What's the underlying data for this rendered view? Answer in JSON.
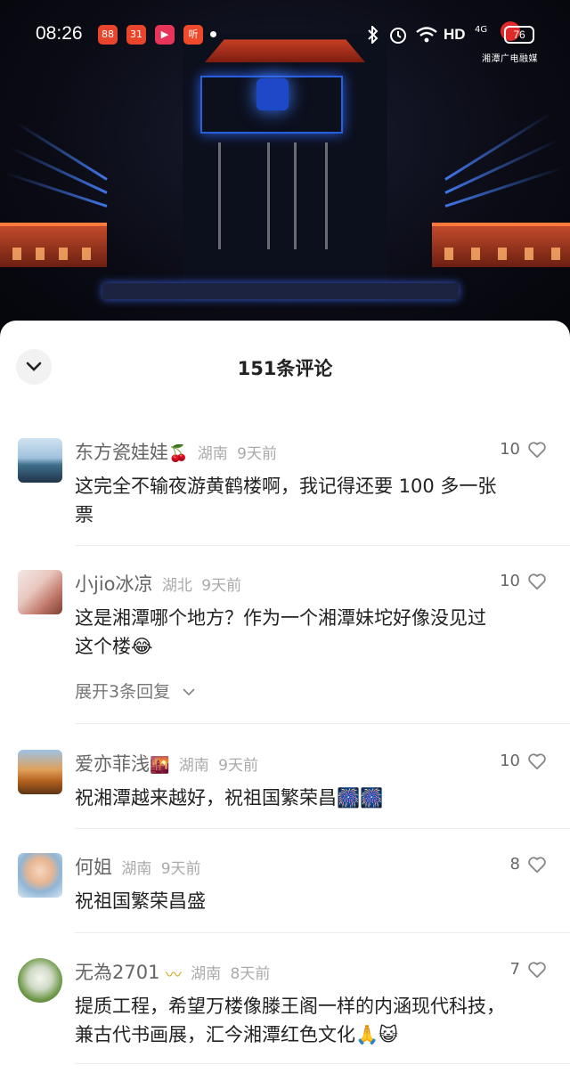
{
  "status_bar": {
    "time": "08:26",
    "apps": [
      "88",
      "31",
      "▶",
      "听"
    ],
    "hd": "HD",
    "signal": "4G",
    "battery": "76",
    "watermark": "湘潭广电融媒"
  },
  "sheet": {
    "title": "151条评论"
  },
  "comments": [
    {
      "name": "东方瓷娃娃",
      "emoji": "🍒",
      "region": "湖南",
      "time": "9天前",
      "likes": "10",
      "text_line1": "这完全不输夜游黄鹤楼啊，我记得还要 100 多一张",
      "text_line2": "票"
    },
    {
      "name": "小jio冰凉",
      "emoji": "",
      "region": "湖北",
      "time": "9天前",
      "likes": "10",
      "text_line1": "这是湘潭哪个地方？作为一个湘潭妹坨好像没见过",
      "text_line2": "这个楼😂",
      "expand_label": "展开3条回复"
    },
    {
      "name": "爱亦菲浅",
      "emoji": "🌇",
      "region": "湖南",
      "time": "9天前",
      "likes": "10",
      "text_line1": "祝湘潭越来越好，祝祖国繁荣昌🎆🎆"
    },
    {
      "name": "何姐",
      "emoji": "",
      "region": "湖南",
      "time": "9天前",
      "likes": "8",
      "text_line1": "祝祖国繁荣昌盛"
    },
    {
      "name": "无為2701",
      "emoji": "〰",
      "region": "湖南",
      "time": "8天前",
      "likes": "7",
      "text_line1": "提质工程，希望万楼像滕王阁一样的内涵现代科技，",
      "text_line2": "兼古代书画展，汇今湘潭红色文化🙏😺"
    }
  ],
  "colors": {
    "heart_outline": "#888888",
    "app_badge_1": "#e8452c",
    "app_badge_2": "#e8452c",
    "app_badge_3": "#e8345a",
    "app_badge_4": "#f04a2c"
  }
}
